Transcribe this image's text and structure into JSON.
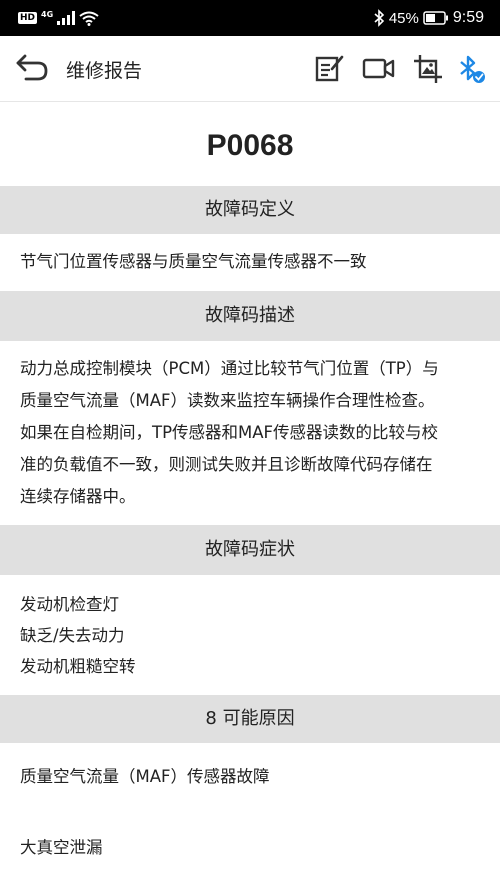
{
  "statusbar": {
    "hd": "HD",
    "network": "4G",
    "battery_pct": "45%",
    "time": "9:59"
  },
  "appbar": {
    "title": "维修报告",
    "icons": [
      "back-arrow-icon",
      "edit-note-icon",
      "video-camera-icon",
      "crop-image-icon",
      "bluetooth-connected-icon"
    ],
    "bluetooth_color": "#1e88e5"
  },
  "code": "P0068",
  "sections": {
    "definition": {
      "header": "故障码定义",
      "text": "节气门位置传感器与质量空气流量传感器不一致"
    },
    "description": {
      "header": "故障码描述",
      "lines": [
        "动力总成控制模块（PCM）通过比较节气门位置（TP）与",
        "质量空气流量（MAF）读数来监控车辆操作合理性检查。",
        "如果在自检期间，TP传感器和MAF传感器读数的比较与校",
        "准的负载值不一致，则测试失败并且诊断故障代码存储在",
        "连续存储器中。"
      ]
    },
    "symptoms": {
      "header": "故障码症状",
      "items": [
        "发动机检查灯",
        "缺乏/失去动力",
        "发动机粗糙空转"
      ]
    },
    "causes": {
      "header": "8 可能原因",
      "items": [
        "质量空气流量（MAF）传感器故障",
        "大真空泄漏"
      ]
    }
  }
}
